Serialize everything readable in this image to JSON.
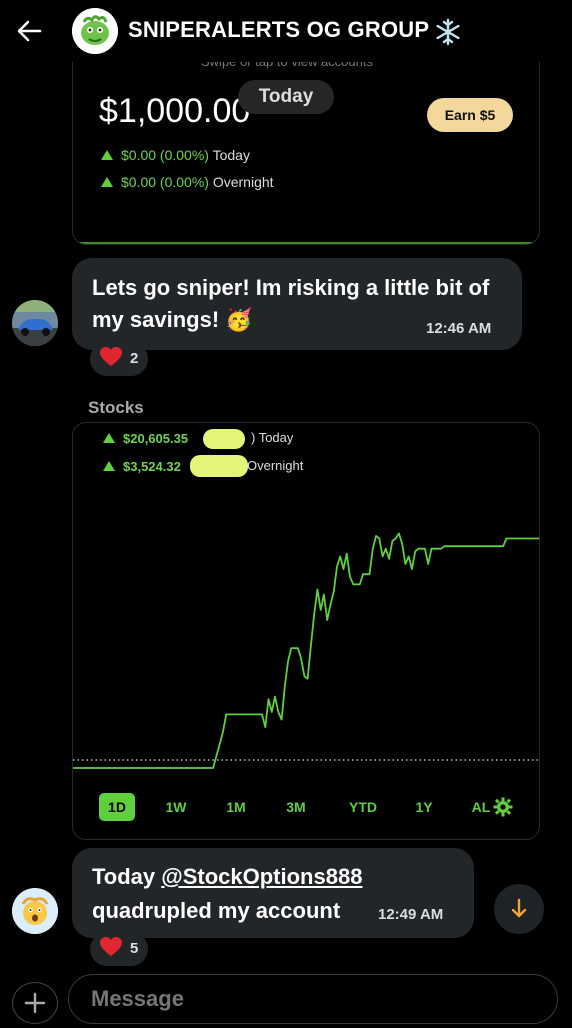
{
  "header": {
    "title": "SNIPERALERTS OG GROUP",
    "title_emoji": "snowflake-icon"
  },
  "portfolio_card": {
    "swipe_hint": "Swipe or tap to view accounts",
    "balance": "$1,000.00",
    "earn_label": "Earn $5",
    "today_change": "$0.00 (0.00%)",
    "today_label": "Today",
    "overnight_change": "$0.00 (0.00%)",
    "overnight_label": "Overnight"
  },
  "date_divider": "Today",
  "messages": [
    {
      "text": "Lets go sniper! Im risking a little bit of my savings! 🥳",
      "time": "12:46 AM",
      "reaction_count": "2"
    },
    {
      "text_prefix": "Today ",
      "mention": "@StockOptions888",
      "text_suffix": "quadrupled my account",
      "time": "12:49 AM",
      "reaction_count": "5"
    }
  ],
  "stocks_card": {
    "label": "Stocks",
    "today_value": "$20,605.35",
    "today_label": ") Today",
    "overnight_value": "$3,524.32",
    "overnight_label": "Overnight",
    "tabs": [
      "1D",
      "1W",
      "1M",
      "3M",
      "YTD",
      "1Y",
      "AL"
    ],
    "active_tab": "1D"
  },
  "chart_data": {
    "type": "line",
    "title": "",
    "xlabel": "",
    "ylabel": "",
    "baseline": 0.0,
    "color": "#5fcf3e",
    "x": [
      0,
      1,
      2,
      3,
      4,
      5,
      6,
      7,
      8,
      9,
      10,
      11,
      12,
      13,
      14,
      15,
      16,
      17,
      18,
      19,
      20,
      21,
      22,
      23,
      24,
      25,
      26,
      27,
      28,
      29,
      30,
      31,
      32,
      33,
      34,
      35,
      36,
      37,
      38,
      39,
      40,
      41,
      42,
      43,
      44,
      45,
      46,
      47,
      48,
      49,
      50,
      51,
      52,
      53,
      54,
      55,
      56,
      57,
      58,
      59,
      60,
      61,
      62,
      63,
      64,
      65,
      66,
      67,
      68,
      69,
      70,
      71,
      72,
      73,
      74,
      75,
      76,
      77,
      78,
      79,
      80
    ],
    "values": [
      0,
      0,
      0,
      0,
      0,
      0,
      0,
      0,
      0,
      0,
      0,
      0,
      0,
      0,
      0,
      0,
      0,
      0,
      0,
      0,
      0,
      0,
      0,
      0,
      0,
      0,
      0,
      0,
      0,
      0,
      0,
      0,
      0,
      0,
      0,
      0,
      0,
      0,
      0,
      0,
      0,
      0,
      0,
      0,
      0,
      0,
      0,
      0,
      0,
      0,
      0,
      0,
      0,
      0,
      0,
      0,
      0,
      0,
      0,
      0,
      0,
      0,
      0,
      0,
      0,
      0,
      0,
      0,
      0,
      0,
      0,
      0,
      0,
      0,
      0,
      0,
      0,
      0,
      0,
      0,
      0
    ],
    "series": [
      {
        "points": [
          [
            0,
            0
          ],
          [
            43,
            0
          ],
          [
            46,
            0.14
          ],
          [
            47,
            0.21
          ],
          [
            58,
            0.21
          ],
          [
            59,
            0.16
          ],
          [
            60,
            0.27
          ],
          [
            61,
            0.22
          ],
          [
            62,
            0.28
          ],
          [
            63,
            0.22
          ],
          [
            64,
            0.19
          ],
          [
            65,
            0.32
          ],
          [
            66,
            0.42
          ],
          [
            67,
            0.47
          ],
          [
            69,
            0.47
          ],
          [
            70,
            0.43
          ],
          [
            71,
            0.36
          ],
          [
            72,
            0.35
          ],
          [
            73,
            0.48
          ],
          [
            74,
            0.6
          ],
          [
            75,
            0.7
          ],
          [
            76,
            0.62
          ],
          [
            77,
            0.68
          ],
          [
            78,
            0.58
          ],
          [
            79,
            0.64
          ],
          [
            80,
            0.69
          ],
          [
            81,
            0.79
          ],
          [
            82,
            0.83
          ],
          [
            83,
            0.78
          ],
          [
            84,
            0.84
          ],
          [
            85,
            0.75
          ],
          [
            86,
            0.72
          ],
          [
            87,
            0.72
          ],
          [
            88,
            0.72
          ],
          [
            89,
            0.76
          ],
          [
            90,
            0.76
          ],
          [
            91,
            0.76
          ],
          [
            92,
            0.86
          ],
          [
            93,
            0.91
          ],
          [
            94,
            0.9
          ],
          [
            95,
            0.83
          ],
          [
            96,
            0.86
          ],
          [
            97,
            0.82
          ],
          [
            98,
            0.89
          ],
          [
            99,
            0.9
          ],
          [
            100,
            0.92
          ],
          [
            101,
            0.88
          ],
          [
            102,
            0.8
          ],
          [
            103,
            0.83
          ],
          [
            104,
            0.78
          ],
          [
            105,
            0.85
          ],
          [
            106,
            0.86
          ],
          [
            107,
            0.86
          ],
          [
            108,
            0.86
          ],
          [
            109,
            0.8
          ],
          [
            110,
            0.86
          ],
          [
            111,
            0.86
          ],
          [
            112,
            0.86
          ],
          [
            113,
            0.86
          ],
          [
            114,
            0.87
          ],
          [
            115,
            0.87
          ],
          [
            116,
            0.87
          ],
          [
            117,
            0.87
          ],
          [
            118,
            0.87
          ],
          [
            119,
            0.87
          ],
          [
            120,
            0.87
          ],
          [
            121,
            0.87
          ],
          [
            122,
            0.87
          ],
          [
            123,
            0.87
          ],
          [
            124,
            0.87
          ],
          [
            125,
            0.87
          ],
          [
            126,
            0.87
          ],
          [
            127,
            0.87
          ],
          [
            128,
            0.87
          ],
          [
            129,
            0.87
          ],
          [
            130,
            0.87
          ],
          [
            131,
            0.87
          ],
          [
            132,
            0.87
          ],
          [
            133,
            0.9
          ],
          [
            134,
            0.9
          ],
          [
            135,
            0.9
          ],
          [
            136,
            0.9
          ],
          [
            137,
            0.9
          ],
          [
            138,
            0.9
          ],
          [
            139,
            0.9
          ],
          [
            140,
            0.9
          ],
          [
            141,
            0.9
          ],
          [
            142,
            0.9
          ],
          [
            143,
            0.9
          ]
        ]
      }
    ]
  },
  "composer": {
    "placeholder": "Message"
  },
  "colors": {
    "accent_green": "#5fcf3e",
    "bubble_bg": "#232629",
    "earn_bg": "#f3d79b"
  }
}
